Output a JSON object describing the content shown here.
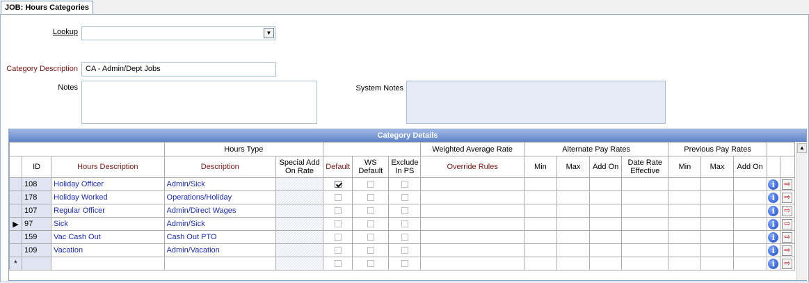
{
  "tab": {
    "label": "JOB: Hours Categories"
  },
  "form": {
    "lookup_label": "Lookup",
    "lookup_value": "",
    "category_description_label": "Category Description",
    "category_description_value": "CA - Admin/Dept Jobs",
    "notes_label": "Notes",
    "notes_value": "",
    "system_notes_label": "System Notes",
    "system_notes_value": ""
  },
  "grid": {
    "caption": "Category Details",
    "group_headers": {
      "hours_type": "Hours Type",
      "weighted_average_rate": "Weighted Average Rate",
      "alternate_pay_rates": "Alternate Pay Rates",
      "previous_pay_rates": "Previous Pay Rates"
    },
    "columns": {
      "id": "ID",
      "hours_description": "Hours Description",
      "description": "Description",
      "special_add_on_rate": "Special Add On Rate",
      "default": "Default",
      "ws_default": "WS Default",
      "exclude_in_ps": "Exclude In PS",
      "override_rules": "Override Rules",
      "alt_min": "Min",
      "alt_max": "Max",
      "alt_add_on": "Add On",
      "date_rate_effective": "Date Rate Effective",
      "prev_min": "Min",
      "prev_max": "Max",
      "prev_add_on": "Add On"
    },
    "rows": [
      {
        "id": "108",
        "hours_description": "Holiday Officer",
        "description": "Admin/Sick",
        "default": true,
        "ws_default": false,
        "exclude_in_ps": false,
        "current": false
      },
      {
        "id": "178",
        "hours_description": "Holiday Worked",
        "description": "Operations/Holiday",
        "default": false,
        "ws_default": false,
        "exclude_in_ps": false,
        "current": false
      },
      {
        "id": "107",
        "hours_description": "Regular Officer",
        "description": "Admin/Direct Wages",
        "default": false,
        "ws_default": false,
        "exclude_in_ps": false,
        "current": false
      },
      {
        "id": "97",
        "hours_description": "Sick",
        "description": "Admin/Sick",
        "default": false,
        "ws_default": false,
        "exclude_in_ps": false,
        "current": true
      },
      {
        "id": "159",
        "hours_description": "Vac Cash Out",
        "description": "Cash Out PTO",
        "default": false,
        "ws_default": false,
        "exclude_in_ps": false,
        "current": false
      },
      {
        "id": "109",
        "hours_description": "Vacation",
        "description": "Admin/Vacation",
        "default": false,
        "ws_default": false,
        "exclude_in_ps": false,
        "current": false
      }
    ],
    "new_row_marker": "*",
    "icons": {
      "info": "info-icon",
      "jump": "jump-to-icon",
      "current_row": "current-row-arrow-icon",
      "scroll_up": "scroll-up-icon",
      "dropdown": "chevron-down-icon"
    }
  }
}
